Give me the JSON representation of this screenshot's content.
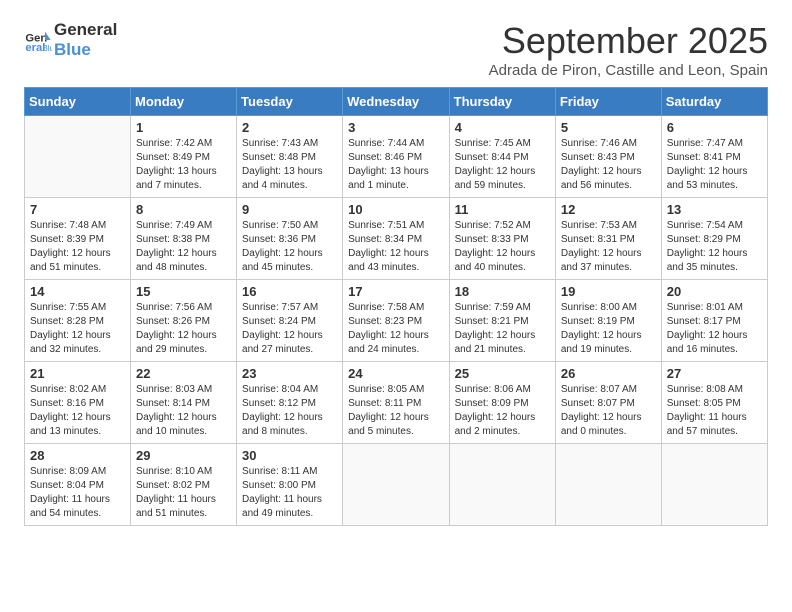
{
  "logo": {
    "line1": "General",
    "line2": "Blue"
  },
  "title": "September 2025",
  "subtitle": "Adrada de Piron, Castille and Leon, Spain",
  "weekdays": [
    "Sunday",
    "Monday",
    "Tuesday",
    "Wednesday",
    "Thursday",
    "Friday",
    "Saturday"
  ],
  "weeks": [
    [
      {
        "day": "",
        "sunrise": "",
        "sunset": "",
        "daylight": ""
      },
      {
        "day": "1",
        "sunrise": "Sunrise: 7:42 AM",
        "sunset": "Sunset: 8:49 PM",
        "daylight": "Daylight: 13 hours and 7 minutes."
      },
      {
        "day": "2",
        "sunrise": "Sunrise: 7:43 AM",
        "sunset": "Sunset: 8:48 PM",
        "daylight": "Daylight: 13 hours and 4 minutes."
      },
      {
        "day": "3",
        "sunrise": "Sunrise: 7:44 AM",
        "sunset": "Sunset: 8:46 PM",
        "daylight": "Daylight: 13 hours and 1 minute."
      },
      {
        "day": "4",
        "sunrise": "Sunrise: 7:45 AM",
        "sunset": "Sunset: 8:44 PM",
        "daylight": "Daylight: 12 hours and 59 minutes."
      },
      {
        "day": "5",
        "sunrise": "Sunrise: 7:46 AM",
        "sunset": "Sunset: 8:43 PM",
        "daylight": "Daylight: 12 hours and 56 minutes."
      },
      {
        "day": "6",
        "sunrise": "Sunrise: 7:47 AM",
        "sunset": "Sunset: 8:41 PM",
        "daylight": "Daylight: 12 hours and 53 minutes."
      }
    ],
    [
      {
        "day": "7",
        "sunrise": "Sunrise: 7:48 AM",
        "sunset": "Sunset: 8:39 PM",
        "daylight": "Daylight: 12 hours and 51 minutes."
      },
      {
        "day": "8",
        "sunrise": "Sunrise: 7:49 AM",
        "sunset": "Sunset: 8:38 PM",
        "daylight": "Daylight: 12 hours and 48 minutes."
      },
      {
        "day": "9",
        "sunrise": "Sunrise: 7:50 AM",
        "sunset": "Sunset: 8:36 PM",
        "daylight": "Daylight: 12 hours and 45 minutes."
      },
      {
        "day": "10",
        "sunrise": "Sunrise: 7:51 AM",
        "sunset": "Sunset: 8:34 PM",
        "daylight": "Daylight: 12 hours and 43 minutes."
      },
      {
        "day": "11",
        "sunrise": "Sunrise: 7:52 AM",
        "sunset": "Sunset: 8:33 PM",
        "daylight": "Daylight: 12 hours and 40 minutes."
      },
      {
        "day": "12",
        "sunrise": "Sunrise: 7:53 AM",
        "sunset": "Sunset: 8:31 PM",
        "daylight": "Daylight: 12 hours and 37 minutes."
      },
      {
        "day": "13",
        "sunrise": "Sunrise: 7:54 AM",
        "sunset": "Sunset: 8:29 PM",
        "daylight": "Daylight: 12 hours and 35 minutes."
      }
    ],
    [
      {
        "day": "14",
        "sunrise": "Sunrise: 7:55 AM",
        "sunset": "Sunset: 8:28 PM",
        "daylight": "Daylight: 12 hours and 32 minutes."
      },
      {
        "day": "15",
        "sunrise": "Sunrise: 7:56 AM",
        "sunset": "Sunset: 8:26 PM",
        "daylight": "Daylight: 12 hours and 29 minutes."
      },
      {
        "day": "16",
        "sunrise": "Sunrise: 7:57 AM",
        "sunset": "Sunset: 8:24 PM",
        "daylight": "Daylight: 12 hours and 27 minutes."
      },
      {
        "day": "17",
        "sunrise": "Sunrise: 7:58 AM",
        "sunset": "Sunset: 8:23 PM",
        "daylight": "Daylight: 12 hours and 24 minutes."
      },
      {
        "day": "18",
        "sunrise": "Sunrise: 7:59 AM",
        "sunset": "Sunset: 8:21 PM",
        "daylight": "Daylight: 12 hours and 21 minutes."
      },
      {
        "day": "19",
        "sunrise": "Sunrise: 8:00 AM",
        "sunset": "Sunset: 8:19 PM",
        "daylight": "Daylight: 12 hours and 19 minutes."
      },
      {
        "day": "20",
        "sunrise": "Sunrise: 8:01 AM",
        "sunset": "Sunset: 8:17 PM",
        "daylight": "Daylight: 12 hours and 16 minutes."
      }
    ],
    [
      {
        "day": "21",
        "sunrise": "Sunrise: 8:02 AM",
        "sunset": "Sunset: 8:16 PM",
        "daylight": "Daylight: 12 hours and 13 minutes."
      },
      {
        "day": "22",
        "sunrise": "Sunrise: 8:03 AM",
        "sunset": "Sunset: 8:14 PM",
        "daylight": "Daylight: 12 hours and 10 minutes."
      },
      {
        "day": "23",
        "sunrise": "Sunrise: 8:04 AM",
        "sunset": "Sunset: 8:12 PM",
        "daylight": "Daylight: 12 hours and 8 minutes."
      },
      {
        "day": "24",
        "sunrise": "Sunrise: 8:05 AM",
        "sunset": "Sunset: 8:11 PM",
        "daylight": "Daylight: 12 hours and 5 minutes."
      },
      {
        "day": "25",
        "sunrise": "Sunrise: 8:06 AM",
        "sunset": "Sunset: 8:09 PM",
        "daylight": "Daylight: 12 hours and 2 minutes."
      },
      {
        "day": "26",
        "sunrise": "Sunrise: 8:07 AM",
        "sunset": "Sunset: 8:07 PM",
        "daylight": "Daylight: 12 hours and 0 minutes."
      },
      {
        "day": "27",
        "sunrise": "Sunrise: 8:08 AM",
        "sunset": "Sunset: 8:05 PM",
        "daylight": "Daylight: 11 hours and 57 minutes."
      }
    ],
    [
      {
        "day": "28",
        "sunrise": "Sunrise: 8:09 AM",
        "sunset": "Sunset: 8:04 PM",
        "daylight": "Daylight: 11 hours and 54 minutes."
      },
      {
        "day": "29",
        "sunrise": "Sunrise: 8:10 AM",
        "sunset": "Sunset: 8:02 PM",
        "daylight": "Daylight: 11 hours and 51 minutes."
      },
      {
        "day": "30",
        "sunrise": "Sunrise: 8:11 AM",
        "sunset": "Sunset: 8:00 PM",
        "daylight": "Daylight: 11 hours and 49 minutes."
      },
      {
        "day": "",
        "sunrise": "",
        "sunset": "",
        "daylight": ""
      },
      {
        "day": "",
        "sunrise": "",
        "sunset": "",
        "daylight": ""
      },
      {
        "day": "",
        "sunrise": "",
        "sunset": "",
        "daylight": ""
      },
      {
        "day": "",
        "sunrise": "",
        "sunset": "",
        "daylight": ""
      }
    ]
  ]
}
